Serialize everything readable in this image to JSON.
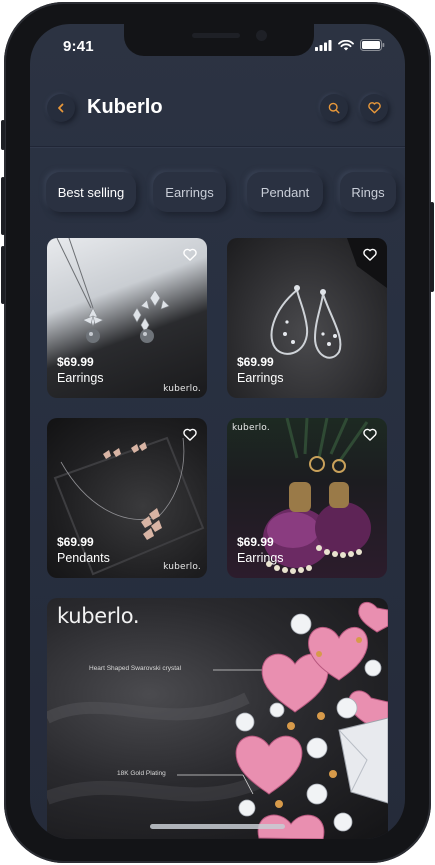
{
  "status": {
    "time": "9:41"
  },
  "header": {
    "title": "Kuberlo",
    "back_icon": "chevron-left-icon",
    "search_icon": "search-icon",
    "favorite_icon": "heart-icon"
  },
  "colors": {
    "accent": "#e8983a",
    "background": "#2a3141"
  },
  "categories": [
    "Best selling",
    "Earrings",
    "Pendant",
    "Rings"
  ],
  "products": [
    {
      "price": "$69.99",
      "category": "Earrings",
      "brand": "kuberlo."
    },
    {
      "price": "$69.99",
      "category": "Earrings"
    },
    {
      "price": "$69.99",
      "category": "Pendants",
      "brand": "kuberlo."
    },
    {
      "price": "$69.99",
      "category": "Earrings",
      "brand": "kuberlo."
    }
  ],
  "banner": {
    "logo": "kuberlo.",
    "annotations": [
      "Heart Shaped Swarovski crystal",
      "18K Gold Plating"
    ]
  }
}
